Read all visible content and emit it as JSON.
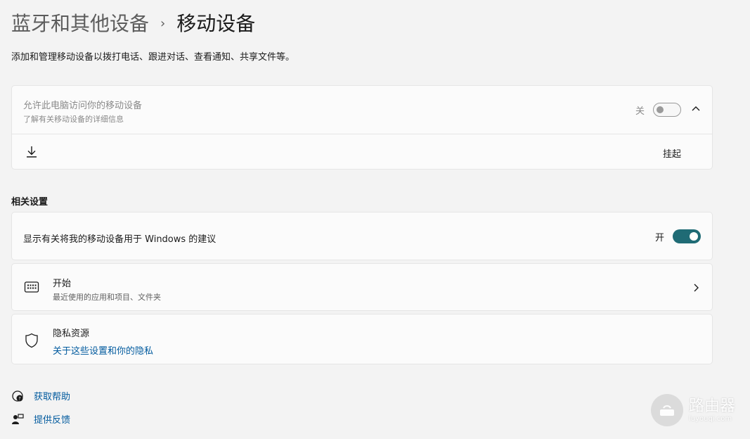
{
  "breadcrumb": {
    "parent": "蓝牙和其他设备",
    "separator": "›",
    "current": "移动设备"
  },
  "subtitle": "添加和管理移动设备以拨打电话、跟进对话、查看通知、共享文件等。",
  "access_card": {
    "title": "允许此电脑访问你的移动设备",
    "link": "了解有关移动设备的详细信息",
    "toggle_label": "关",
    "toggle_state": "off",
    "pending_label": "挂起"
  },
  "related": {
    "heading": "相关设置",
    "suggestions": {
      "title": "显示有关将我的移动设备用于 Windows 的建议",
      "toggle_label": "开",
      "toggle_state": "on"
    },
    "start": {
      "title": "开始",
      "desc": "最近使用的应用和项目、文件夹"
    },
    "privacy": {
      "title": "隐私资源",
      "link": "关于这些设置和你的隐私"
    }
  },
  "footer": {
    "help": "获取帮助",
    "feedback": "提供反馈"
  },
  "watermark": {
    "main": "路由器",
    "sub": "luyouqi.com"
  },
  "colors": {
    "accent": "#1f6b75",
    "link": "#005a9e",
    "background": "#f3f3f3",
    "card": "#fbfbfb"
  }
}
